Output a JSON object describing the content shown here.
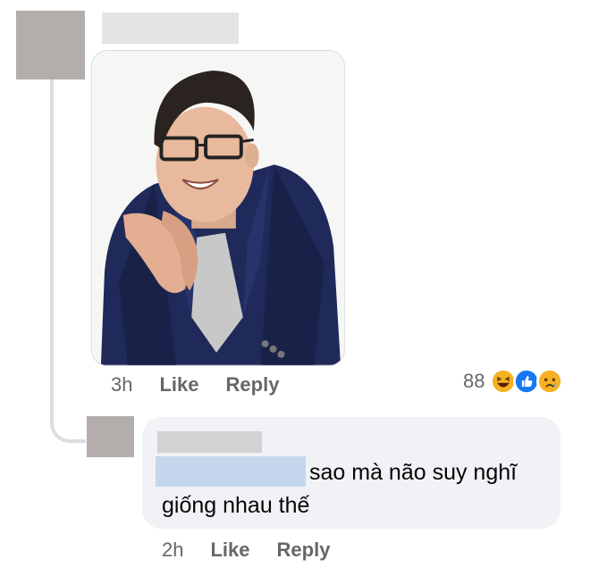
{
  "comment": {
    "time": "3h",
    "like_label": "Like",
    "reply_label": "Reply",
    "reaction_count": "88",
    "reactions": [
      {
        "icon": "haha-reaction-icon",
        "color": "#f7b125"
      },
      {
        "icon": "like-reaction-icon",
        "color": "#1877f2"
      },
      {
        "icon": "sad-reaction-icon",
        "color": "#f7b125"
      }
    ]
  },
  "reply": {
    "text_line1": "sao mà não suy nghĩ",
    "text_line2": "giống nhau thế",
    "time": "2h",
    "like_label": "Like",
    "reply_label": "Reply"
  },
  "colors": {
    "bubble": "#f0f2f5",
    "meta": "#65676b",
    "redaction": "#b3aeac",
    "mention_redaction": "#c5d7ec"
  }
}
